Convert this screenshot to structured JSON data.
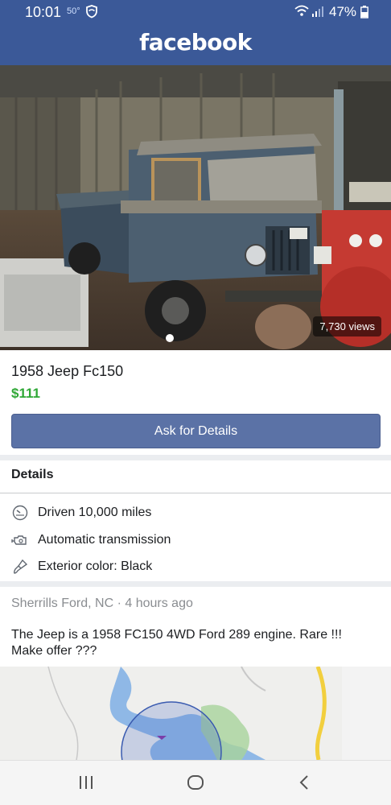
{
  "status_bar": {
    "time": "10:01",
    "temperature": "50°",
    "battery": "47%"
  },
  "header": {
    "logo": "facebook",
    "color": "#3b5998"
  },
  "photo": {
    "views": "7,730 views"
  },
  "listing": {
    "title": "1958 Jeep Fc150",
    "price": "$111",
    "price_color": "#2fa836",
    "ask_button": "Ask for Details"
  },
  "details": {
    "heading": "Details",
    "items": [
      {
        "icon": "speedometer-icon",
        "text": "Driven 10,000 miles"
      },
      {
        "icon": "engine-icon",
        "text": "Automatic transmission"
      },
      {
        "icon": "paint-brush-icon",
        "text": "Exterior color: Black"
      }
    ]
  },
  "location_meta": "Sherrills Ford, NC · 4 hours ago",
  "description": "The Jeep is a 1958 FC150 4WD Ford 289 engine.  Rare !!! Make offer ???",
  "nav_bar": {
    "icons": [
      "recent-apps-icon",
      "home-icon",
      "back-icon"
    ]
  }
}
